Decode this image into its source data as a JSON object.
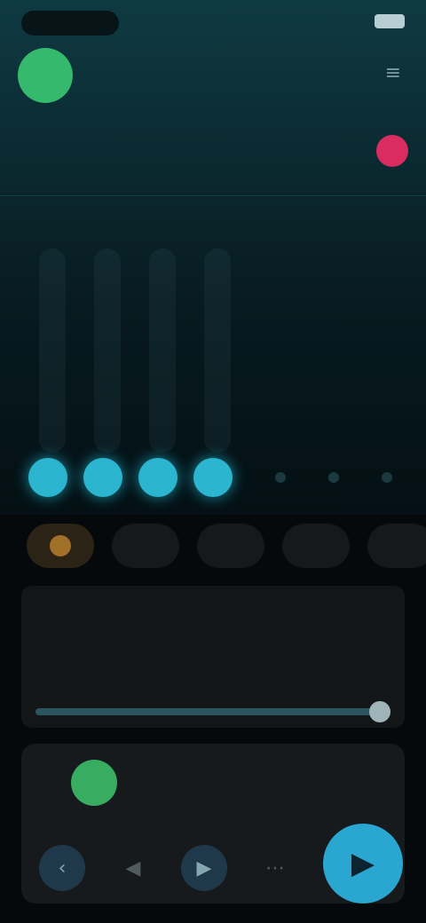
{
  "status_bar": {
    "pill_text": "",
    "signal_text": "",
    "wifi_text": ""
  },
  "header": {
    "title": "",
    "menu_icon": "menu-icon"
  },
  "info": {
    "small_label": "",
    "big_value": "",
    "right_label": ""
  },
  "chips": [
    {
      "label": ""
    },
    {
      "label": ""
    },
    {
      "label": ""
    },
    {
      "label": ""
    },
    {
      "label": ""
    }
  ],
  "card": {
    "title": "",
    "subtitle": ""
  },
  "player": {
    "track_title": "",
    "time": "",
    "icons": {
      "prev": "chevron-left-icon",
      "back": "rewind-icon",
      "next": "forward-icon",
      "more": "dots-icon",
      "play": "play-icon"
    }
  },
  "colors": {
    "accent": "#2cb5cf",
    "green": "#35b96d",
    "badge": "#ff2d6a",
    "chip_active": "#b88a2e"
  }
}
